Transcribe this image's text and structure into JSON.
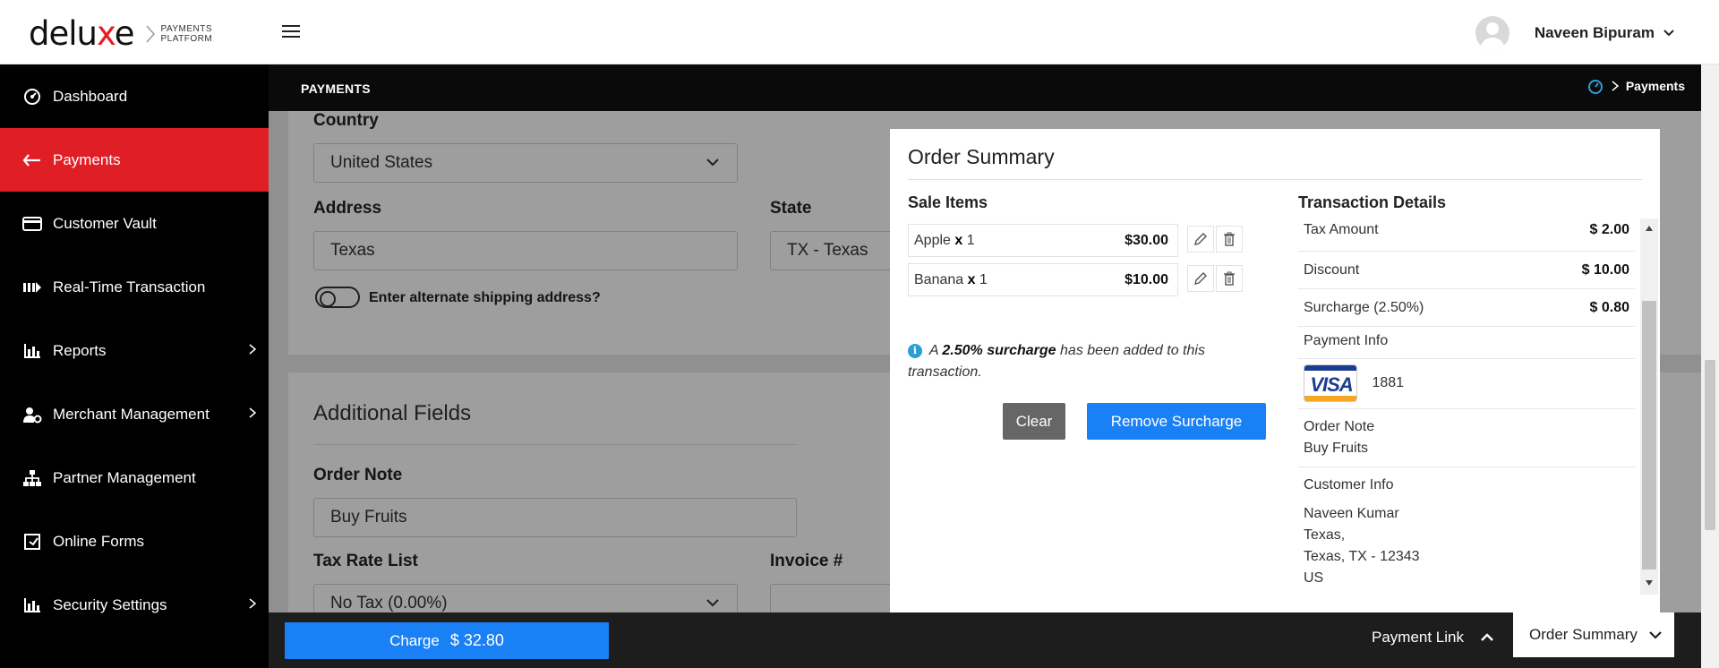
{
  "header": {
    "logo_text": "deluxe",
    "logo_sub_line1": "PAYMENTS",
    "logo_sub_line2": "PLATFORM",
    "user_name": "Naveen Bipuram"
  },
  "sidebar": {
    "items": [
      {
        "label": "Dashboard",
        "icon": "dashboard-icon",
        "active": false
      },
      {
        "label": "Payments",
        "icon": "arrow-left-icon",
        "active": true
      },
      {
        "label": "Customer Vault",
        "icon": "card-icon",
        "active": false
      },
      {
        "label": "Real-Time Transaction",
        "icon": "stream-icon",
        "active": false
      },
      {
        "label": "Reports",
        "icon": "bar-chart-icon",
        "active": false,
        "has_children": true
      },
      {
        "label": "Merchant Management",
        "icon": "user-gear-icon",
        "active": false,
        "has_children": true
      },
      {
        "label": "Partner Management",
        "icon": "sitemap-icon",
        "active": false
      },
      {
        "label": "Online Forms",
        "icon": "form-icon",
        "active": false
      },
      {
        "label": "Security Settings",
        "icon": "bar-chart-icon",
        "active": false,
        "has_children": true
      }
    ]
  },
  "subheader": {
    "section": "PAYMENTS",
    "breadcrumb": "Payments"
  },
  "form": {
    "country_label": "Country",
    "country_value": "United States",
    "address_label": "Address",
    "address_value": "Texas",
    "state_label": "State",
    "state_value": "TX - Texas",
    "alt_shipping_label": "Enter alternate shipping address?",
    "additional_title": "Additional Fields",
    "order_note_label": "Order Note",
    "order_note_value": "Buy Fruits",
    "tax_rate_label": "Tax Rate List",
    "tax_rate_value": "No Tax (0.00%)",
    "invoice_label": "Invoice #"
  },
  "order_summary": {
    "title": "Order Summary",
    "sale_items_title": "Sale Items",
    "sale_items": [
      {
        "name": "Apple",
        "qty": "1",
        "amount": "$30.00"
      },
      {
        "name": "Banana",
        "qty": "1",
        "amount": "$10.00"
      }
    ],
    "notice_prefix": "A",
    "notice_bold": "2.50% surcharge",
    "notice_suffix": "has been added to this transaction.",
    "clear_label": "Clear",
    "remove_surcharge_label": "Remove Surcharge",
    "transaction_details_title": "Transaction Details",
    "details": [
      {
        "label": "Tax Amount",
        "value": "$ 2.00"
      },
      {
        "label": "Discount",
        "value": "$ 10.00"
      },
      {
        "label": "Surcharge (2.50%)",
        "value": "$ 0.80"
      }
    ],
    "payment_info_label": "Payment Info",
    "card_brand": "VISA",
    "card_last4": "1881",
    "order_note_label": "Order Note",
    "order_note_value": "Buy Fruits",
    "customer_info_label": "Customer Info",
    "customer_name": "Naveen Kumar",
    "customer_line1": "Texas,",
    "customer_line2": "Texas, TX - 12343",
    "customer_country": "US"
  },
  "bottom": {
    "charge_label": "Charge",
    "charge_amount": "$ 32.80",
    "payment_link_label": "Payment Link",
    "order_summary_label": "Order Summary"
  },
  "colors": {
    "brand_red": "#e01e26",
    "primary_blue": "#1a80f5",
    "sidebar_bg": "#000000"
  }
}
